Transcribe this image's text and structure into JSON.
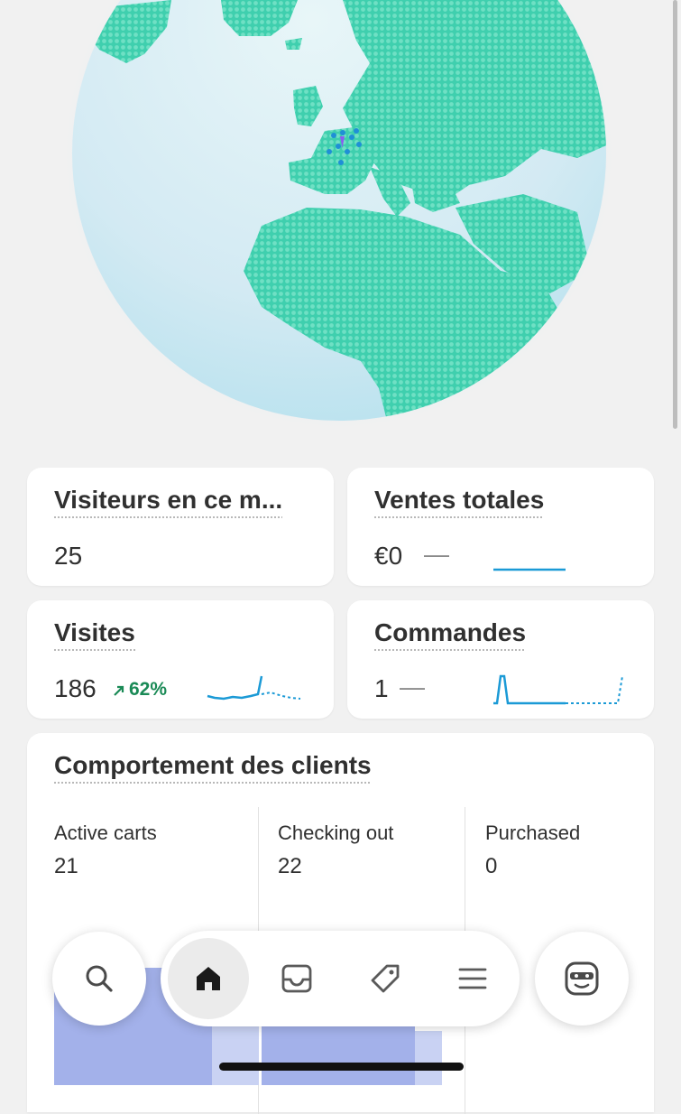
{
  "colors": {
    "globe_land": "#4fd6b6",
    "globe_sea": "#d6ecf3",
    "sparkline": "#1b9ad6",
    "trend_up": "#1a8a56",
    "chart_bar": "#9eabe6"
  },
  "cards": {
    "visitors_now": {
      "title": "Visiteurs en ce m...",
      "value": "25"
    },
    "total_sales": {
      "title": "Ventes totales",
      "value": "€0",
      "change": "—"
    },
    "visits": {
      "title": "Visites",
      "value": "186",
      "trend": "62%",
      "trend_icon": "arrow-up-right-icon"
    },
    "orders": {
      "title": "Commandes",
      "value": "1",
      "change": "—"
    }
  },
  "behavior": {
    "title": "Comportement des clients",
    "columns": [
      {
        "label": "Active carts",
        "value": "21"
      },
      {
        "label": "Checking out",
        "value": "22"
      },
      {
        "label": "Purchased",
        "value": "0"
      }
    ]
  },
  "nav": {
    "search_icon": "search-icon",
    "home_icon": "home-icon",
    "inbox_icon": "inbox-icon",
    "tag_icon": "tag-icon",
    "menu_icon": "menu-icon",
    "avatar_icon": "avatar-icon"
  }
}
